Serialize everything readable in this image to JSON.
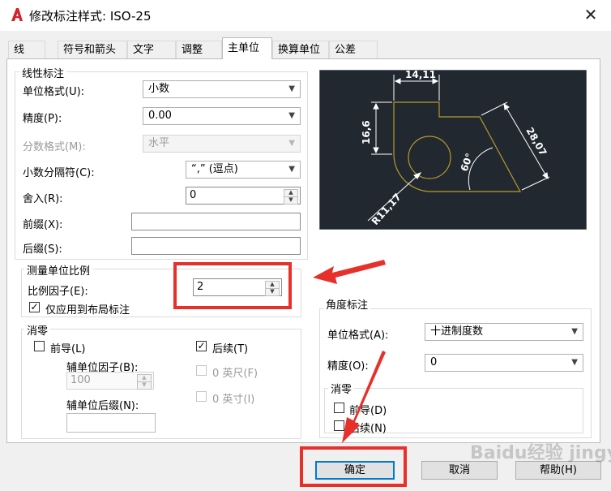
{
  "window": {
    "title": "修改标注样式: ISO-25"
  },
  "tabs": [
    "线",
    "符号和箭头",
    "文字",
    "调整",
    "主单位",
    "换算单位",
    "公差"
  ],
  "linear": {
    "legend": "线性标注",
    "unit_format_label": "单位格式(U):",
    "unit_format_value": "小数",
    "precision_label": "精度(P):",
    "precision_value": "0.00",
    "fraction_label": "分数格式(M):",
    "fraction_value": "水平",
    "decimal_sep_label": "小数分隔符(C):",
    "decimal_sep_value": "“,” (逗点)",
    "round_label": "舍入(R):",
    "round_value": "0",
    "prefix_label": "前缀(X):",
    "prefix_value": "",
    "suffix_label": "后缀(S):",
    "suffix_value": ""
  },
  "scale": {
    "legend": "测量单位比例",
    "factor_label": "比例因子(E):",
    "factor_value": "2",
    "layout_only_label": "仅应用到布局标注",
    "layout_only_checked": true
  },
  "zero_suppression": {
    "legend": "消零",
    "leading_label": "前导(L)",
    "leading_checked": false,
    "sub_factor_label": "辅单位因子(B):",
    "sub_factor_value": "100",
    "sub_suffix_label": "辅单位后缀(N):",
    "sub_suffix_value": "",
    "trailing_label": "后续(T)",
    "trailing_checked": true,
    "feet_label": "0 英尺(F)",
    "inches_label": "0 英寸(I)"
  },
  "preview": {
    "dims": [
      "14,11",
      "16,6",
      "28,07",
      "60°",
      "R11,17"
    ],
    "colors": {
      "bg": "#212830",
      "geometry": "#b89a2a",
      "dims": "#ffffff"
    }
  },
  "angular": {
    "legend": "角度标注",
    "unit_format_label": "单位格式(A):",
    "unit_format_value": "十进制度数",
    "precision_label": "精度(O):",
    "precision_value": "0",
    "zero_legend": "消零",
    "leading_label": "前导(D)",
    "trailing_label": "后续(N)"
  },
  "buttons": {
    "ok": "确定",
    "cancel": "取消",
    "help": "帮助(H)"
  },
  "watermark": "Baidu经验 jingyan.baidu.com",
  "annotation_colors": {
    "highlight": "#e8302b"
  }
}
